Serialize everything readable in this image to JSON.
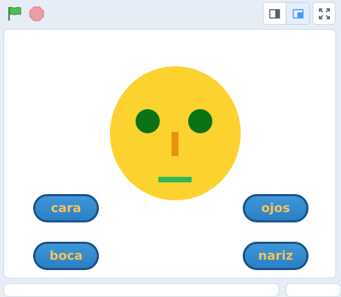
{
  "toolbar": {
    "green_flag": "green-flag-icon",
    "stop": "stop-icon",
    "small_stage": "small-stage-icon",
    "normal_stage": "normal-stage-icon",
    "fullscreen": "fullscreen-icon"
  },
  "stage": {
    "buttons": {
      "cara": "cara",
      "ojos": "ojos",
      "boca": "boca",
      "nariz": "nariz"
    }
  },
  "colors": {
    "face": "#fcd22f",
    "eyes": "#0b7216",
    "nose": "#e8900f",
    "mouth": "#2fb85a",
    "button_fill": "#3a8fd4",
    "button_border": "#17518a",
    "button_text": "#f4c35c"
  }
}
